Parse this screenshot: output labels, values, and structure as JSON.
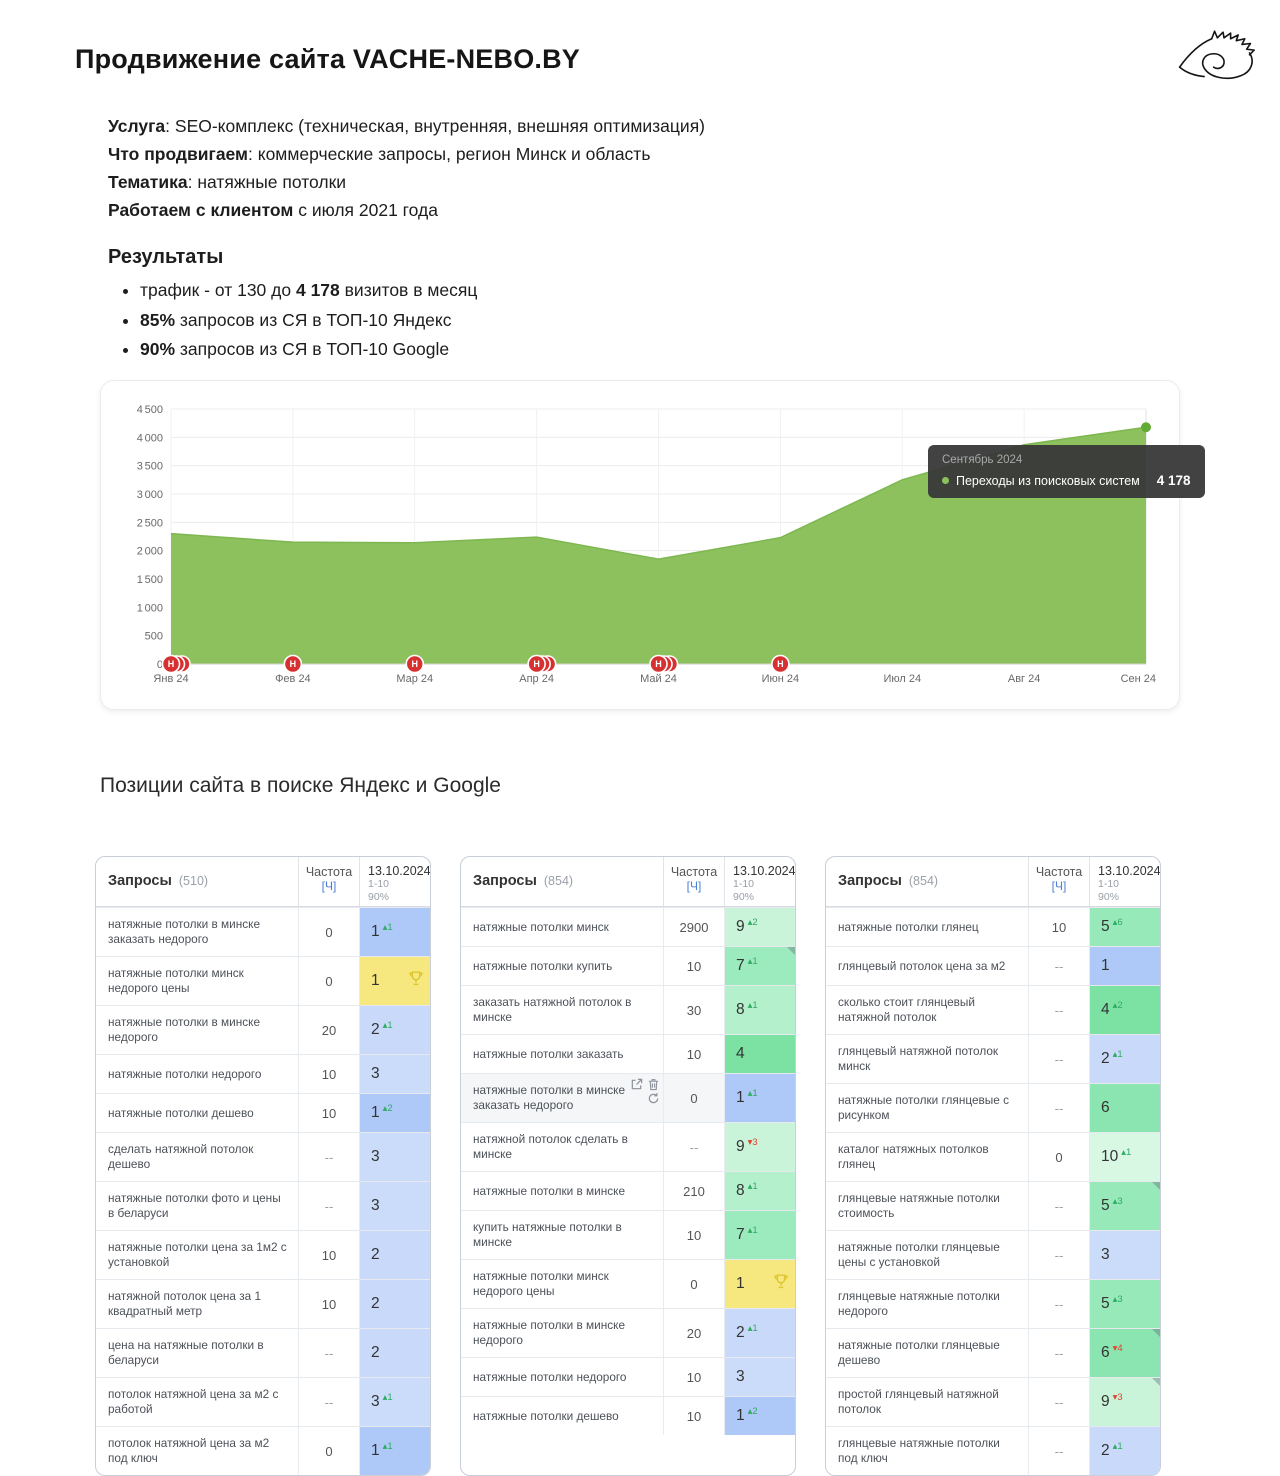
{
  "header": {
    "title": "Продвижение сайта VACHE-NEBO.BY",
    "info": [
      {
        "label": "Услуга",
        "rest": ": SEO-комплекс (техническая, внутренняя, внешняя оптимизация)"
      },
      {
        "label": "Что продвигаем",
        "rest": ": коммерческие запросы, регион Минск и область"
      },
      {
        "label": "Тематика",
        "rest": ": натяжные потолки"
      },
      {
        "label": "Работаем с клиентом",
        "rest": " с июля 2021 года"
      }
    ]
  },
  "results": {
    "title": "Результаты",
    "bullets": [
      {
        "pre": "трафик - от 130 до ",
        "bold": "4 178",
        "post": " визитов в месяц"
      },
      {
        "pre": "",
        "bold": "85%",
        "post": " запросов из СЯ в ТОП-10 Яндекс"
      },
      {
        "pre": "",
        "bold": "90%",
        "post": " запросов из СЯ в ТОП-10 Google"
      }
    ]
  },
  "chart_data": {
    "type": "area",
    "title": "Переходы из поисковых систем",
    "x": [
      "Янв 24",
      "Фев 24",
      "Мар 24",
      "Апр 24",
      "Май 24",
      "Июн 24",
      "Июл 24",
      "Авг 24",
      "Сен 24"
    ],
    "series": [
      {
        "name": "Переходы из поисковых систем",
        "values": [
          2300,
          2150,
          2140,
          2240,
          1850,
          2230,
          3250,
          3870,
          4178
        ]
      }
    ],
    "ylim": [
      0,
      4500
    ],
    "ytick_step": 500,
    "grid": true,
    "legend_position": "tooltip",
    "area_color": "#8cc15e",
    "line_color": "#7eb750",
    "dot_color": "#63aa34",
    "marker_color": "#d63031",
    "marker_letter": "Н",
    "markers": [
      {
        "month": 0,
        "count": 3
      },
      {
        "month": 1,
        "count": 1
      },
      {
        "month": 2,
        "count": 1
      },
      {
        "month": 3,
        "count": 3
      },
      {
        "month": 4,
        "count": 3
      },
      {
        "month": 5,
        "count": 1
      }
    ],
    "tooltip": {
      "title": "Сентябрь 2024",
      "label": "Переходы из поисковых систем",
      "value": "4 178"
    }
  },
  "positions": {
    "title": "Позиции сайта в поиске Яндекс и Google",
    "pos_colors": {
      "1": "#aec8f7",
      "2": "#c8d9f9",
      "3": "#cadcf9",
      "4": "#7ce2a4",
      "5": "#98e9ba",
      "6": "#8be5b0",
      "7": "#9cebbf",
      "8": "#b5f0cd",
      "9": "#c9f4d9",
      "10": "#d9f8e4",
      "yellow": "#f6e87e"
    },
    "tables": [
      {
        "title": "Запросы",
        "count": "(510)",
        "freq_header": "Частота",
        "freq_unit": "[Ч]",
        "date_header": "13.10.2024",
        "date_sub1": "1-10",
        "date_sub2": "90%",
        "rows": [
          {
            "query": "натяжные потолки в минске заказать недорого",
            "freq": "0",
            "pos": "1",
            "delta": "1",
            "dir": "up"
          },
          {
            "query": "натяжные потолки минск недорого цены",
            "freq": "0",
            "pos": "1",
            "variant": "yellow",
            "trophy": true
          },
          {
            "query": "натяжные потолки в минске недорого",
            "freq": "20",
            "pos": "2",
            "delta": "1",
            "dir": "up"
          },
          {
            "query": "натяжные потолки недорого",
            "freq": "10",
            "pos": "3"
          },
          {
            "query": "натяжные потолки дешево",
            "freq": "10",
            "pos": "1",
            "delta": "2",
            "dir": "up"
          },
          {
            "query": "сделать натяжной потолок дешево",
            "freq": "--",
            "pos": "3"
          },
          {
            "query": "натяжные потолки фото и цены в беларуси",
            "freq": "--",
            "pos": "3"
          },
          {
            "query": "натяжные потолки цена за 1м2 с установкой",
            "freq": "10",
            "pos": "2"
          },
          {
            "query": "натяжной потолок цена за 1 квадратный метр",
            "freq": "10",
            "pos": "2"
          },
          {
            "query": "цена на натяжные потолки в беларуси",
            "freq": "--",
            "pos": "2"
          },
          {
            "query": "потолок натяжной цена за м2 с работой",
            "freq": "--",
            "pos": "3",
            "delta": "1",
            "dir": "up"
          },
          {
            "query": "потолок натяжной цена за м2 под ключ",
            "freq": "0",
            "pos": "1",
            "delta": "1",
            "dir": "up"
          }
        ]
      },
      {
        "title": "Запросы",
        "count": "(854)",
        "freq_header": "Частота",
        "freq_unit": "[Ч]",
        "date_header": "13.10.2024",
        "date_sub1": "1-10",
        "date_sub2": "90%",
        "rows": [
          {
            "query": "натяжные потолки минск",
            "freq": "2900",
            "pos": "9",
            "delta": "2",
            "dir": "up"
          },
          {
            "query": "натяжные потолки купить",
            "freq": "10",
            "pos": "7",
            "delta": "1",
            "dir": "up",
            "fold": true
          },
          {
            "query": "заказать натяжной потолок в минске",
            "freq": "30",
            "pos": "8",
            "delta": "1",
            "dir": "up"
          },
          {
            "query": "натяжные потолки заказать",
            "freq": "10",
            "pos": "4"
          },
          {
            "query": "натяжные потолки в минске заказать недорого",
            "freq": "0",
            "pos": "1",
            "delta": "1",
            "dir": "up",
            "hover_icons": true
          },
          {
            "query": "натяжной потолок сделать в минске",
            "freq": "--",
            "pos": "9",
            "delta": "3",
            "dir": "down"
          },
          {
            "query": "натяжные потолки в минске",
            "freq": "210",
            "pos": "8",
            "delta": "1",
            "dir": "up"
          },
          {
            "query": "купить натяжные потолки в минске",
            "freq": "10",
            "pos": "7",
            "delta": "1",
            "dir": "up"
          },
          {
            "query": "натяжные потолки минск недорого цены",
            "freq": "0",
            "pos": "1",
            "variant": "yellow",
            "trophy": true
          },
          {
            "query": "натяжные потолки в минске недорого",
            "freq": "20",
            "pos": "2",
            "delta": "1",
            "dir": "up"
          },
          {
            "query": "натяжные потолки недорого",
            "freq": "10",
            "pos": "3"
          },
          {
            "query": "натяжные потолки дешево",
            "freq": "10",
            "pos": "1",
            "delta": "2",
            "dir": "up"
          }
        ]
      },
      {
        "title": "Запросы",
        "count": "(854)",
        "freq_header": "Частота",
        "freq_unit": "[Ч]",
        "date_header": "13.10.2024",
        "date_sub1": "1-10",
        "date_sub2": "90%",
        "rows": [
          {
            "query": "натяжные потолки глянец",
            "freq": "10",
            "pos": "5",
            "delta": "6",
            "dir": "up"
          },
          {
            "query": "глянцевый потолок цена за м2",
            "freq": "--",
            "pos": "1"
          },
          {
            "query": "сколько стоит глянцевый натяжной потолок",
            "freq": "--",
            "pos": "4",
            "delta": "2",
            "dir": "up"
          },
          {
            "query": "глянцевый натяжной потолок минск",
            "freq": "--",
            "pos": "2",
            "delta": "1",
            "dir": "up"
          },
          {
            "query": "натяжные потолки глянцевые с рисунком",
            "freq": "--",
            "pos": "6"
          },
          {
            "query": "каталог натяжных потолков глянец",
            "freq": "0",
            "pos": "10",
            "delta": "1",
            "dir": "up"
          },
          {
            "query": "глянцевые натяжные потолки стоимость",
            "freq": "--",
            "pos": "5",
            "delta": "3",
            "dir": "up",
            "fold": true
          },
          {
            "query": "натяжные потолки глянцевые цены с установкой",
            "freq": "--",
            "pos": "3"
          },
          {
            "query": "глянцевые натяжные потолки недорого",
            "freq": "--",
            "pos": "5",
            "delta": "3",
            "dir": "up"
          },
          {
            "query": "натяжные потолки глянцевые дешево",
            "freq": "--",
            "pos": "6",
            "delta": "4",
            "dir": "down",
            "fold": true
          },
          {
            "query": "простой глянцевый натяжной потолок",
            "freq": "--",
            "pos": "9",
            "delta": "3",
            "dir": "down",
            "fold": true
          },
          {
            "query": "глянцевые натяжные потолки под ключ",
            "freq": "--",
            "pos": "2",
            "delta": "1",
            "dir": "up"
          }
        ]
      }
    ]
  }
}
